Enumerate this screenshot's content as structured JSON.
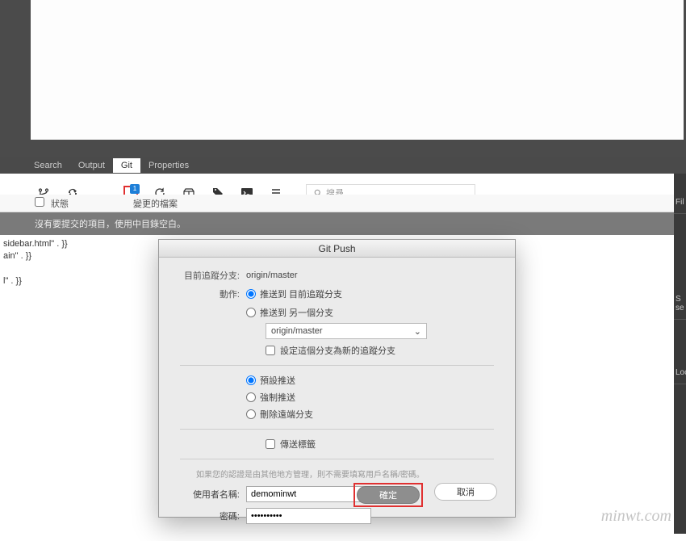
{
  "tabs": {
    "search": "Search",
    "output": "Output",
    "git": "Git",
    "properties": "Properties"
  },
  "toolbar": {
    "badge": "1",
    "search_placeholder": "搜尋"
  },
  "sub": {
    "status": "狀態",
    "changed": "變更的檔案"
  },
  "status": "沒有要提交的項目，使用中目錄空白。",
  "code": {
    "l1": "sidebar.html\" . }}",
    "l2": "ain\" . }}",
    "l3": "l\" . }}"
  },
  "right": {
    "fil": "Fil",
    "s": "S",
    "se": "se",
    "loc": "Loc"
  },
  "dialog": {
    "title": "Git Push",
    "tracking_label": "目前追蹤分支:",
    "tracking_value": "origin/master",
    "action_label": "動作:",
    "action_opt1": "推送到 目前追蹤分支",
    "action_opt2": "推送到 另一個分支",
    "branch_select": "origin/master",
    "set_tracking": "設定這個分支為新的追蹤分支",
    "push_default": "預設推送",
    "push_force": "強制推送",
    "push_delete": "刪除遠端分支",
    "send_tags": "傳送標籤",
    "hint": "如果您的認證是由其他地方管理，則不需要填寫用戶名稱/密碼。",
    "username_label": "使用者名稱:",
    "username_value": "demominwt",
    "password_label": "密碼:",
    "password_value": "••••••••••",
    "ok": "確定",
    "cancel": "取消"
  },
  "watermark": "minwt.com"
}
